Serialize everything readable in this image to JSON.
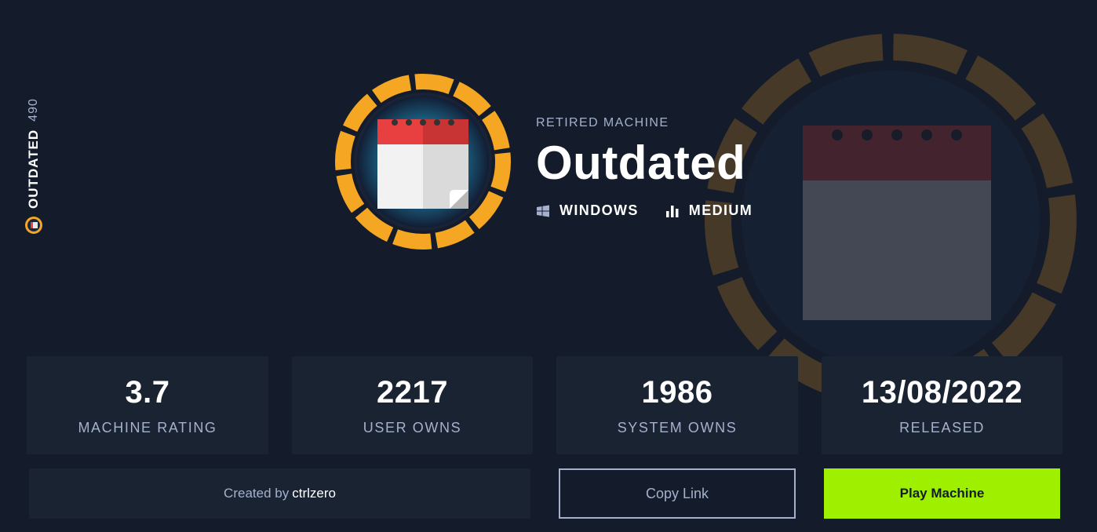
{
  "side": {
    "name": "OUTDATED",
    "number": "490",
    "icon": "machine-badge-icon"
  },
  "header": {
    "kicker": "RETIRED MACHINE",
    "title": "Outdated",
    "os": {
      "label": "WINDOWS",
      "icon": "windows-icon"
    },
    "difficulty": {
      "label": "MEDIUM",
      "icon": "difficulty-bars-icon"
    }
  },
  "avatar": {
    "icon": "calendar-icon",
    "ring_color": "#f5a623"
  },
  "stats": [
    {
      "value": "3.7",
      "label": "MACHINE RATING"
    },
    {
      "value": "2217",
      "label": "USER OWNS"
    },
    {
      "value": "1986",
      "label": "SYSTEM OWNS"
    },
    {
      "value": "13/08/2022",
      "label": "RELEASED"
    }
  ],
  "actions": {
    "created_prefix": "Created by",
    "creator": "ctrlzero",
    "copy_link": "Copy Link",
    "play": "Play Machine"
  },
  "colors": {
    "background": "#141b2a",
    "card": "#1a2332",
    "accent": "#9fef00",
    "muted": "#a4b1cd",
    "ring": "#f5a623"
  }
}
